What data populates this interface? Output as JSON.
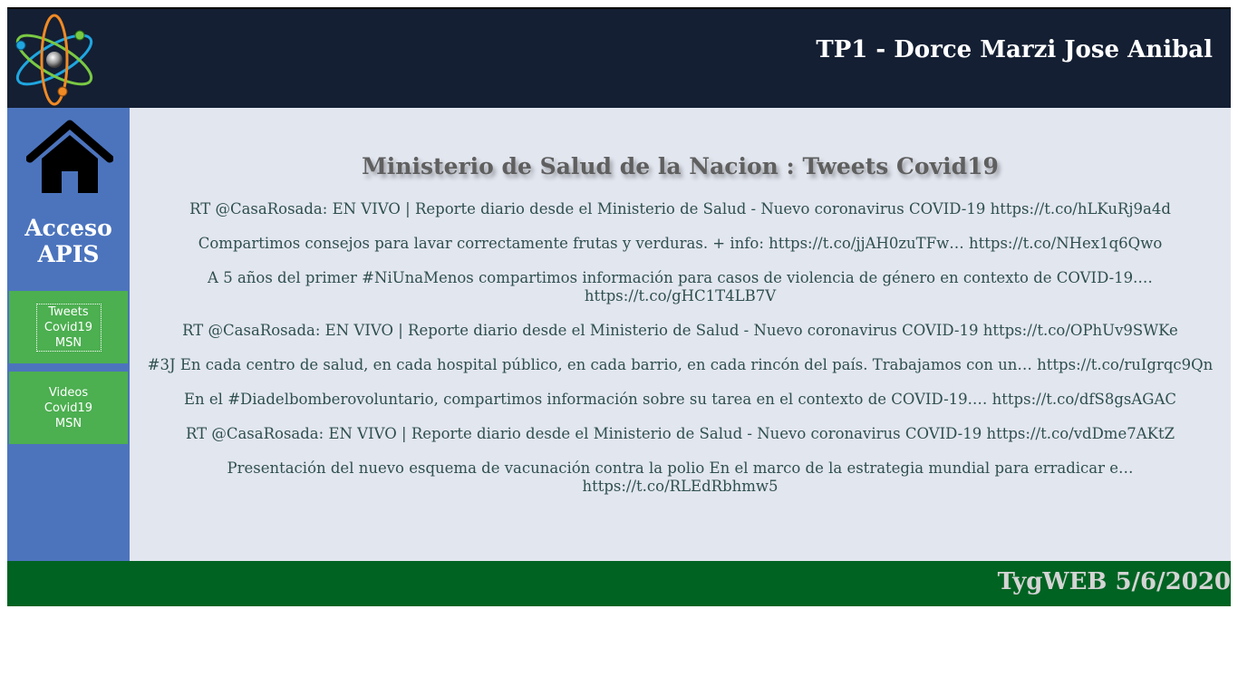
{
  "header": {
    "title": "TP1 - Dorce Marzi Jose Anibal",
    "logo_icon": "atom-icon"
  },
  "sidebar": {
    "home_icon": "home-icon",
    "heading": "Acceso APIS",
    "items": [
      {
        "label": "Tweets Covid19 MSN",
        "active": true
      },
      {
        "label": "Videos Covid19 MSN",
        "active": false
      }
    ]
  },
  "main": {
    "title": "Ministerio de Salud de la Nacion : Tweets Covid19",
    "tweets": [
      "RT @CasaRosada: EN VIVO | Reporte diario desde el Ministerio de Salud - Nuevo coronavirus COVID-19 https://t.co/hLKuRj9a4d",
      "Compartimos consejos para lavar correctamente frutas y verduras. + info: https://t.co/jjAH0zuTFw… https://t.co/NHex1q6Qwo",
      "A 5 años del primer #NiUnaMenos compartimos información para casos de violencia de género en contexto de COVID-19.… https://t.co/gHC1T4LB7V",
      "RT @CasaRosada: EN VIVO | Reporte diario desde el Ministerio de Salud - Nuevo coronavirus COVID-19 https://t.co/OPhUv9SWKe",
      "#3J En cada centro de salud, en cada hospital público, en cada barrio, en cada rincón del país. Trabajamos con un… https://t.co/ruIgrqc9Qn",
      "En el #Diadelbomberovoluntario, compartimos información sobre su tarea en el contexto de COVID-19.… https://t.co/dfS8gsAGAC",
      "RT @CasaRosada: EN VIVO | Reporte diario desde el Ministerio de Salud - Nuevo coronavirus COVID-19 https://t.co/vdDme7AKtZ",
      "Presentación del nuevo esquema de vacunación contra la polio En el marco de la estrategia mundial para erradicar e… https://t.co/RLEdRbhmw5"
    ]
  },
  "footer": {
    "text": "TygWEB 5/6/2020"
  },
  "colors": {
    "header_bg": "#141f33",
    "sidebar_bg": "#4c74bd",
    "button_bg": "#4caf50",
    "main_bg": "#e2e6ef",
    "footer_bg": "#006322",
    "tweet_text": "#2f4f4f"
  }
}
